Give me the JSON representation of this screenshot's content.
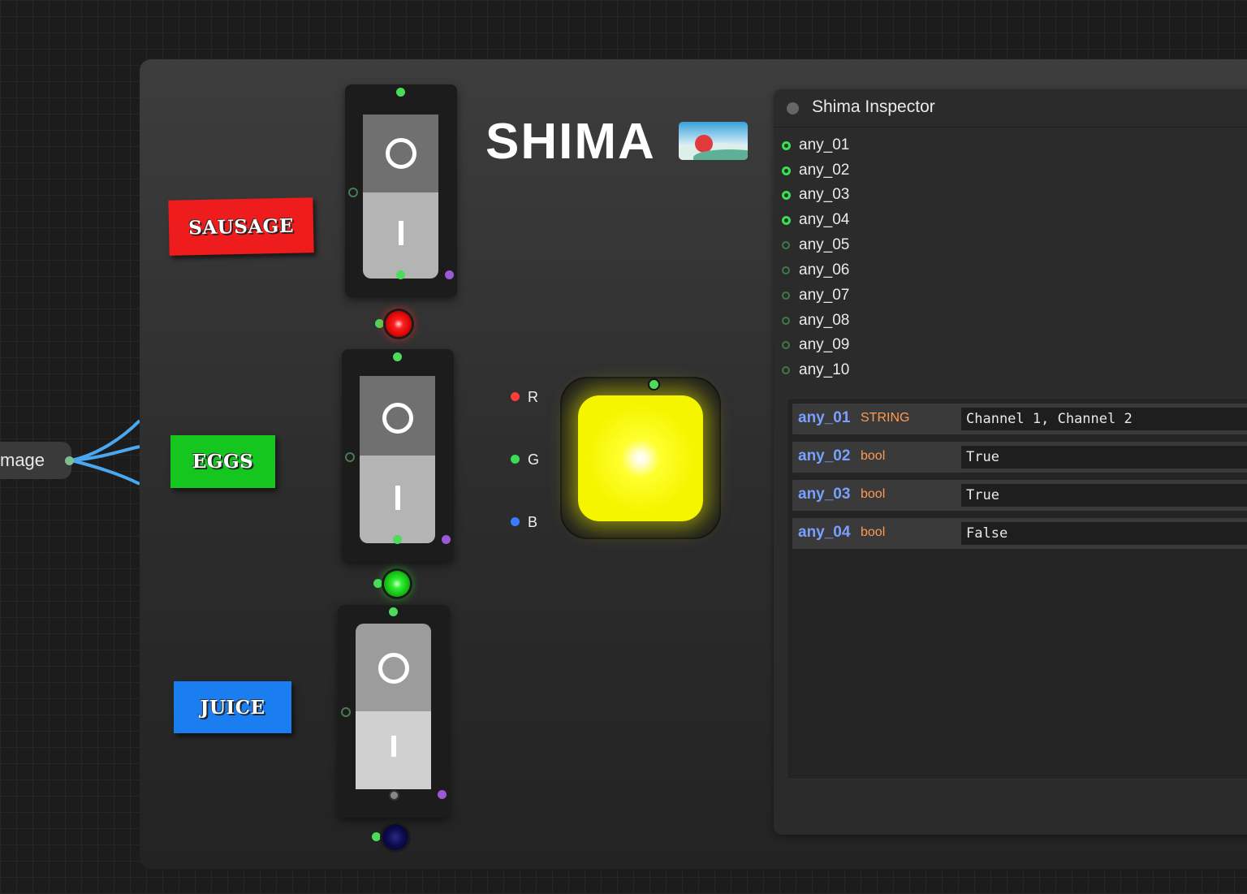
{
  "image_node": {
    "label": "mage"
  },
  "logo": {
    "text": "SHIMA"
  },
  "buttons": [
    {
      "key": "sausage",
      "label": "SAUSAGE",
      "color": "#ee1c1c"
    },
    {
      "key": "eggs",
      "label": "EGGS",
      "color": "#14c61e"
    },
    {
      "key": "juice",
      "label": "JUICE",
      "color": "#1a7ef0"
    }
  ],
  "switches": [
    {
      "key": "sausage",
      "off_symbol": "O",
      "on_symbol": "I"
    },
    {
      "key": "eggs",
      "off_symbol": "O",
      "on_symbol": "I"
    },
    {
      "key": "juice",
      "off_symbol": "O",
      "on_symbol": "I"
    }
  ],
  "leds": [
    {
      "key": "sausage",
      "color": "#ff1a1a",
      "state": "on"
    },
    {
      "key": "eggs",
      "color": "#22dd22",
      "state": "on"
    },
    {
      "key": "juice",
      "color": "#0a0a40",
      "state": "off"
    }
  ],
  "rgb_inputs": [
    {
      "label": "R",
      "color": "#ff3b3b"
    },
    {
      "label": "G",
      "color": "#3ddc55"
    },
    {
      "label": "B",
      "color": "#3b7bff"
    }
  ],
  "output_color": "#ffff00",
  "inspector": {
    "title": "Shima Inspector",
    "ports": [
      {
        "label": "any_01",
        "connected": true
      },
      {
        "label": "any_02",
        "connected": true
      },
      {
        "label": "any_03",
        "connected": true
      },
      {
        "label": "any_04",
        "connected": true
      },
      {
        "label": "any_05",
        "connected": false
      },
      {
        "label": "any_06",
        "connected": false
      },
      {
        "label": "any_07",
        "connected": false
      },
      {
        "label": "any_08",
        "connected": false
      },
      {
        "label": "any_09",
        "connected": false
      },
      {
        "label": "any_10",
        "connected": false
      }
    ],
    "rows": [
      {
        "name": "any_01",
        "type": "STRING",
        "value": "Channel 1, Channel 2"
      },
      {
        "name": "any_02",
        "type": "bool",
        "value": "True"
      },
      {
        "name": "any_03",
        "type": "bool",
        "value": "True"
      },
      {
        "name": "any_04",
        "type": "bool",
        "value": "False"
      }
    ]
  }
}
